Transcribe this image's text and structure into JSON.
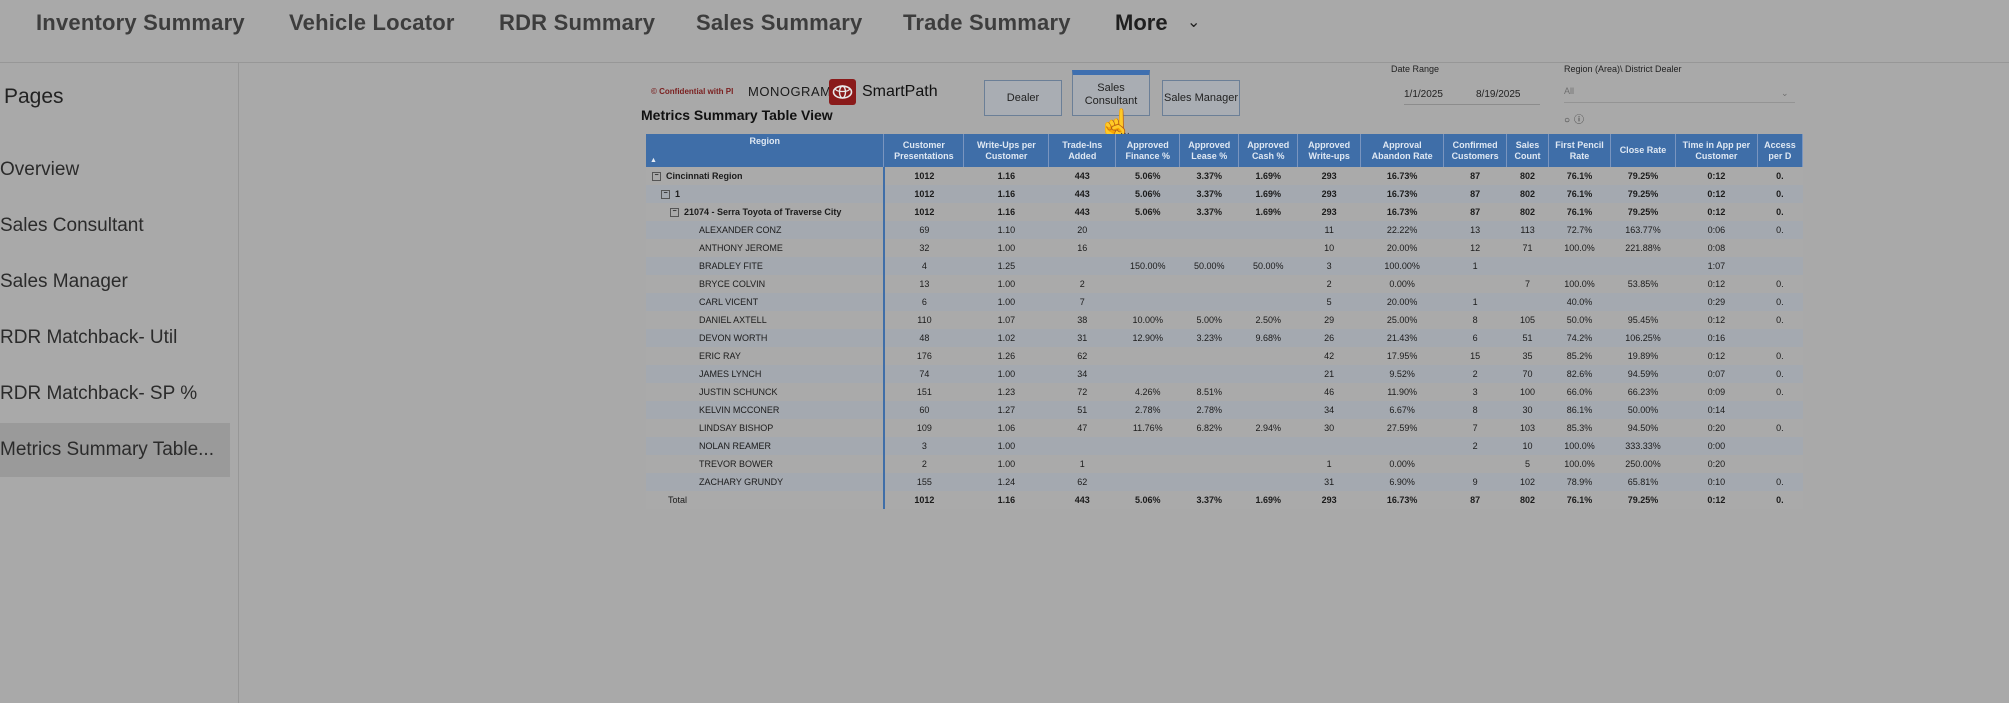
{
  "topnav": {
    "tabs": [
      "Inventory Summary",
      "Vehicle Locator",
      "RDR Summary",
      "Sales Summary",
      "Trade Summary"
    ],
    "more_label": "More"
  },
  "sidebar": {
    "title": "Pages",
    "items": [
      {
        "label": "Overview"
      },
      {
        "label": "Sales Consultant"
      },
      {
        "label": "Sales Manager"
      },
      {
        "label": "RDR Matchback- Util"
      },
      {
        "label": "RDR Matchback- SP %"
      },
      {
        "label": "Metrics Summary Table..."
      }
    ]
  },
  "report": {
    "confidential": "© Confidential with PI",
    "monogram": "MONOGRAM",
    "brand": "SmartPath",
    "title": "Metrics Summary Table View",
    "segments": [
      "Dealer",
      "Sales Consultant",
      "Sales Manager"
    ],
    "active_segment": "Sales Consultant",
    "date_range": {
      "label": "Date Range",
      "from": "1/1/2025",
      "to": "8/19/2025"
    },
    "region_filter": {
      "label": "Region (Area)\\ District Dealer",
      "value": "All"
    },
    "columns": [
      "Region",
      "Customer Presentations",
      "Write-Ups per Customer",
      "Trade-Ins Added",
      "Approved Finance %",
      "Approved Lease %",
      "Approved Cash %",
      "Approved Write-ups",
      "Approval Abandon Rate",
      "Confirmed Customers",
      "Sales Count",
      "First Pencil Rate",
      "Close Rate",
      "Time in App per Customer",
      "Access per D"
    ],
    "rows": [
      {
        "level": 0,
        "expander": "⊟",
        "cells": [
          "Cincinnati Region",
          "1012",
          "1.16",
          "443",
          "5.06%",
          "3.37%",
          "1.69%",
          "293",
          "16.73%",
          "87",
          "802",
          "76.1%",
          "79.25%",
          "0:12",
          "0."
        ],
        "bold": true
      },
      {
        "level": 1,
        "expander": "⊟",
        "cells": [
          "1",
          "1012",
          "1.16",
          "443",
          "5.06%",
          "3.37%",
          "1.69%",
          "293",
          "16.73%",
          "87",
          "802",
          "76.1%",
          "79.25%",
          "0:12",
          "0."
        ],
        "bold": true
      },
      {
        "level": 2,
        "expander": "⊟",
        "cells": [
          "21074 - Serra Toyota of Traverse City",
          "1012",
          "1.16",
          "443",
          "5.06%",
          "3.37%",
          "1.69%",
          "293",
          "16.73%",
          "87",
          "802",
          "76.1%",
          "79.25%",
          "0:12",
          "0."
        ],
        "bold": true
      },
      {
        "level": 3,
        "cells": [
          "ALEXANDER CONZ",
          "69",
          "1.10",
          "20",
          "",
          "",
          "",
          "11",
          "22.22%",
          "13",
          "113",
          "72.7%",
          "163.77%",
          "0:06",
          "0."
        ]
      },
      {
        "level": 3,
        "cells": [
          "ANTHONY JEROME",
          "32",
          "1.00",
          "16",
          "",
          "",
          "",
          "10",
          "20.00%",
          "12",
          "71",
          "100.0%",
          "221.88%",
          "0:08",
          ""
        ]
      },
      {
        "level": 3,
        "cells": [
          "BRADLEY FITE",
          "4",
          "1.25",
          "",
          "150.00%",
          "50.00%",
          "50.00%",
          "3",
          "100.00%",
          "1",
          "",
          "",
          "",
          "1:07",
          ""
        ]
      },
      {
        "level": 3,
        "cells": [
          "BRYCE COLVIN",
          "13",
          "1.00",
          "2",
          "",
          "",
          "",
          "2",
          "0.00%",
          "",
          "7",
          "100.0%",
          "53.85%",
          "0:12",
          "0."
        ]
      },
      {
        "level": 3,
        "cells": [
          "CARL VICENT",
          "6",
          "1.00",
          "7",
          "",
          "",
          "",
          "5",
          "20.00%",
          "1",
          "",
          "40.0%",
          "",
          "0:29",
          "0."
        ]
      },
      {
        "level": 3,
        "cells": [
          "DANIEL AXTELL",
          "110",
          "1.07",
          "38",
          "10.00%",
          "5.00%",
          "2.50%",
          "29",
          "25.00%",
          "8",
          "105",
          "50.0%",
          "95.45%",
          "0:12",
          "0."
        ]
      },
      {
        "level": 3,
        "cells": [
          "DEVON WORTH",
          "48",
          "1.02",
          "31",
          "12.90%",
          "3.23%",
          "9.68%",
          "26",
          "21.43%",
          "6",
          "51",
          "74.2%",
          "106.25%",
          "0:16",
          ""
        ]
      },
      {
        "level": 3,
        "cells": [
          "ERIC RAY",
          "176",
          "1.26",
          "62",
          "",
          "",
          "",
          "42",
          "17.95%",
          "15",
          "35",
          "85.2%",
          "19.89%",
          "0:12",
          "0."
        ]
      },
      {
        "level": 3,
        "cells": [
          "JAMES LYNCH",
          "74",
          "1.00",
          "34",
          "",
          "",
          "",
          "21",
          "9.52%",
          "2",
          "70",
          "82.6%",
          "94.59%",
          "0:07",
          "0."
        ]
      },
      {
        "level": 3,
        "cells": [
          "JUSTIN SCHUNCK",
          "151",
          "1.23",
          "72",
          "4.26%",
          "8.51%",
          "",
          "46",
          "11.90%",
          "3",
          "100",
          "66.0%",
          "66.23%",
          "0:09",
          "0."
        ]
      },
      {
        "level": 3,
        "cells": [
          "KELVIN MCCONER",
          "60",
          "1.27",
          "51",
          "2.78%",
          "2.78%",
          "",
          "34",
          "6.67%",
          "8",
          "30",
          "86.1%",
          "50.00%",
          "0:14",
          ""
        ]
      },
      {
        "level": 3,
        "cells": [
          "LINDSAY BISHOP",
          "109",
          "1.06",
          "47",
          "11.76%",
          "6.82%",
          "2.94%",
          "30",
          "27.59%",
          "7",
          "103",
          "85.3%",
          "94.50%",
          "0:20",
          "0."
        ]
      },
      {
        "level": 3,
        "cells": [
          "NOLAN REAMER",
          "3",
          "1.00",
          "",
          "",
          "",
          "",
          "",
          "",
          "2",
          "10",
          "100.0%",
          "333.33%",
          "0:00",
          ""
        ]
      },
      {
        "level": 3,
        "cells": [
          "TREVOR BOWER",
          "2",
          "1.00",
          "1",
          "",
          "",
          "",
          "1",
          "0.00%",
          "",
          "5",
          "100.0%",
          "250.00%",
          "0:20",
          ""
        ]
      },
      {
        "level": 3,
        "cells": [
          "ZACHARY GRUNDY",
          "155",
          "1.24",
          "62",
          "",
          "",
          "",
          "31",
          "6.90%",
          "9",
          "102",
          "78.9%",
          "65.81%",
          "0:10",
          "0."
        ]
      }
    ],
    "total": [
      "Total",
      "1012",
      "1.16",
      "443",
      "5.06%",
      "3.37%",
      "1.69%",
      "293",
      "16.73%",
      "87",
      "802",
      "76.1%",
      "79.25%",
      "0:12",
      "0."
    ]
  }
}
